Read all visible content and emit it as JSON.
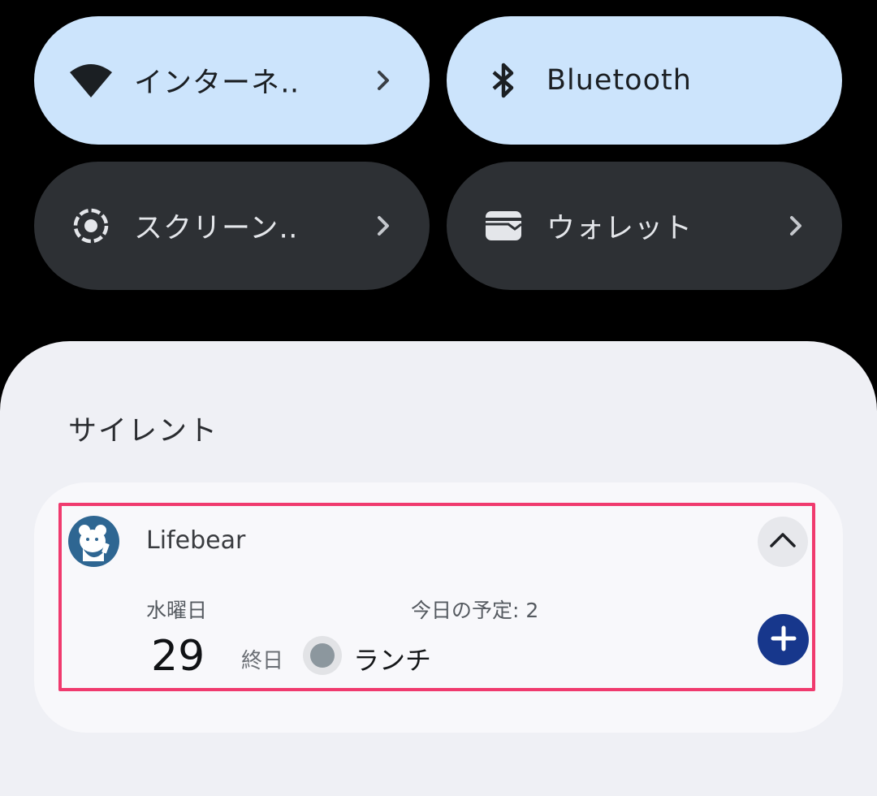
{
  "quick_tiles": [
    {
      "label": "インターネ‥",
      "icon": "wifi-icon",
      "state": "on",
      "has_chevron": true
    },
    {
      "label": "Bluetooth",
      "icon": "bluetooth-icon",
      "state": "on",
      "has_chevron": false
    },
    {
      "label": "スクリーン‥",
      "icon": "screen-record-icon",
      "state": "off",
      "has_chevron": true
    },
    {
      "label": "ウォレット",
      "icon": "wallet-icon",
      "state": "off",
      "has_chevron": true
    }
  ],
  "notifications": {
    "section_title": "サイレント",
    "card": {
      "app_name": "Lifebear",
      "app_icon": "lifebear-bear-icon",
      "weekday": "水曜日",
      "today_count": "今日の予定: 2",
      "day": "29",
      "event": {
        "time": "終日",
        "title": "ランチ",
        "color": "#8c979e"
      }
    }
  },
  "colors": {
    "tile_on": "#cce4fc",
    "tile_off": "#2d3034",
    "highlight_border": "#f03a6e",
    "add_button": "#17378c",
    "app_icon_bg": "#2e6692"
  }
}
